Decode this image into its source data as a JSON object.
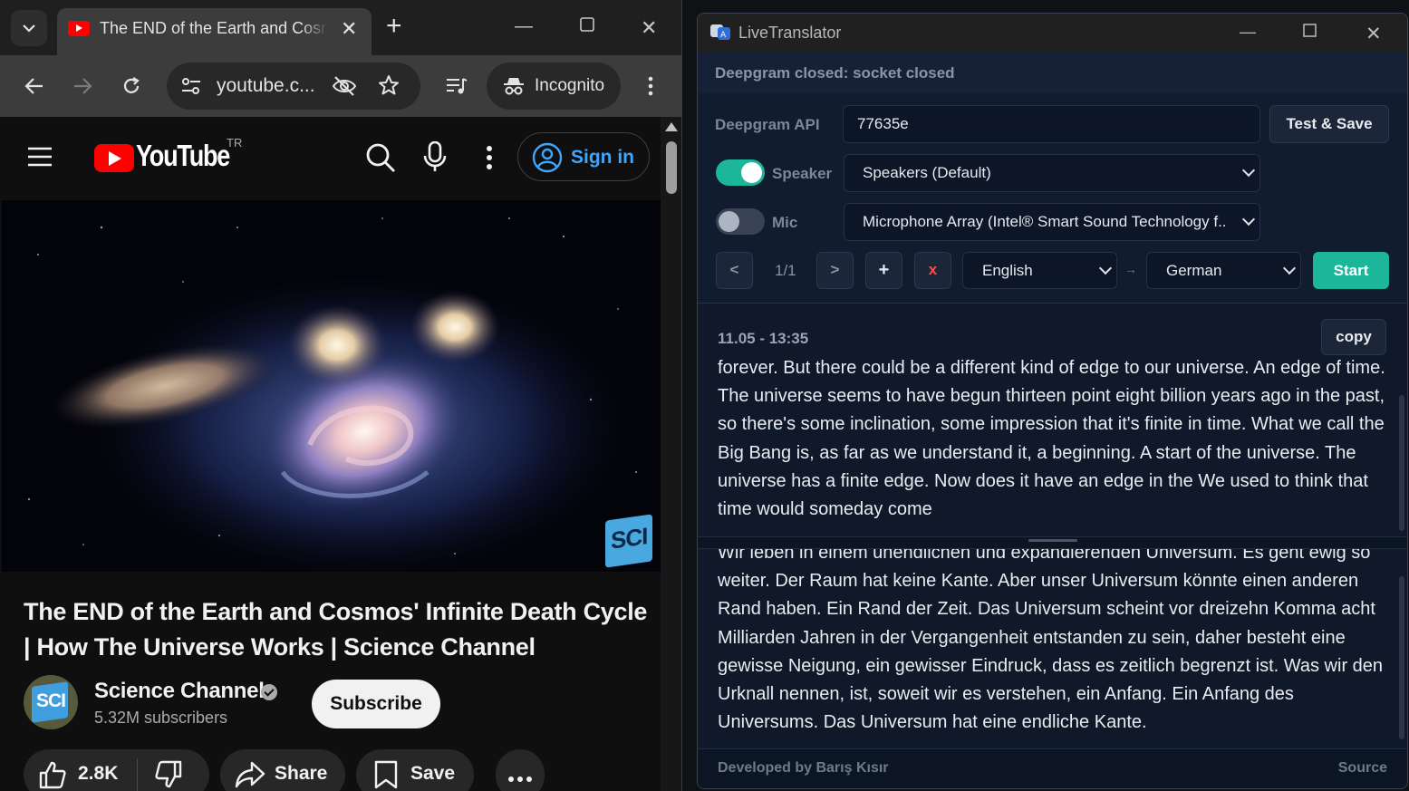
{
  "browser": {
    "tab_title": "The END of the Earth and Cosmos' Infinite Death Cycle | How The Universe Works | Science Channel",
    "url": "youtube.c...",
    "incognito_label": "Incognito"
  },
  "youtube": {
    "wordmark": "YouTube",
    "region": "TR",
    "sign_in": "Sign in",
    "video_title": "The END of the Earth and Cosmos' Infinite Death Cycle | How The Universe Works | Science Channel",
    "channel_badge": "SCI",
    "channel_name": "Science Channel",
    "subscribers": "5.32M subscribers",
    "subscribe": "Subscribe",
    "likes": "2.8K",
    "share": "Share",
    "save": "Save"
  },
  "translator": {
    "app_title": "LiveTranslator",
    "status": "Deepgram closed: socket closed",
    "api_label": "Deepgram API",
    "api_value": "77635e",
    "test_save": "Test & Save",
    "speaker_label": "Speaker",
    "speaker_enabled": true,
    "speaker_device": "Speakers (Default)",
    "mic_label": "Mic",
    "mic_enabled": false,
    "mic_device": "Microphone Array (Intel® Smart Sound Technology f...",
    "prev": "<",
    "page": "1/1",
    "next": ">",
    "add": "+",
    "remove": "x",
    "source_lang": "English",
    "arrow": "→",
    "target_lang": "German",
    "start": "Start",
    "timestamp": "11.05 - 13:35",
    "copy": "copy",
    "source_text": "forever. But there could be a different kind of edge to our universe. An edge of time. The universe seems to have begun thirteen point eight billion years ago in the past, so there's some inclination, some impression that it's finite in time. What we call the Big Bang is, as far as we understand it, a beginning. A start of the universe. The universe has a finite edge. Now does it have an edge in the We used to think that time would someday come",
    "target_text": "Wir leben in einem unendlichen und expandierenden Universum. Es geht ewig so weiter. Der Raum hat keine Kante. Aber unser Universum könnte einen anderen Rand haben. Ein Rand der Zeit. Das Universum scheint vor dreizehn Komma acht Milliarden Jahren in der Vergangenheit entstanden zu sein, daher besteht eine gewisse Neigung, ein gewisser Eindruck, dass es zeitlich begrenzt ist. Was wir den Urknall nennen, ist, soweit wir es verstehen, ein Anfang. Ein Anfang des Universums. Das Universum hat eine endliche Kante.",
    "footer_dev": "Developed by Barış Kısır",
    "footer_source": "Source",
    "accent_color": "#1cb79b"
  }
}
